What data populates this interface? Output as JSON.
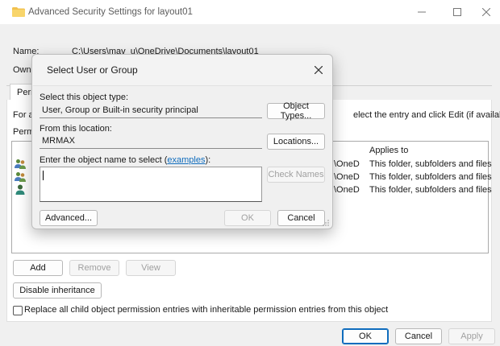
{
  "window": {
    "title": "Advanced Security Settings for layout01",
    "name_label": "Name:",
    "name_value": "C:\\Users\\mav_u\\OneDrive\\Documents\\layout01",
    "owner_label_partial": "Owne",
    "tab_label_partial": "Perm",
    "instruction_left": "For a",
    "instruction_right": "elect the entry and click Edit (if available).",
    "perm_label_partial": "Perm",
    "list": {
      "applies_to_header": "Applies to",
      "rows": [
        {
          "inherited_partial": "\\OneD",
          "applies_to": "This folder, subfolders and files"
        },
        {
          "inherited_partial": "\\OneD",
          "applies_to": "This folder, subfolders and files"
        },
        {
          "inherited_partial": "\\OneD",
          "applies_to": "This folder, subfolders and files"
        }
      ]
    },
    "buttons": {
      "add": "Add",
      "remove": "Remove",
      "view": "View",
      "disable_inheritance": "Disable inheritance",
      "ok": "OK",
      "cancel": "Cancel",
      "apply": "Apply"
    },
    "replace_checkbox_label": "Replace all child object permission entries with inheritable permission entries from this object"
  },
  "dialog": {
    "title": "Select User or Group",
    "object_type_label": "Select this object type:",
    "object_type_value": "User, Group or Built-in security principal",
    "object_types_button": "Object Types...",
    "location_label": "From this location:",
    "location_value": "MRMAX",
    "locations_button": "Locations...",
    "enter_name_label_prefix": "Enter the object name to select (",
    "examples_link": "examples",
    "enter_name_label_suffix": "):",
    "object_name_value": "",
    "check_names_button": "Check Names",
    "advanced_button": "Advanced...",
    "ok_button": "OK",
    "cancel_button": "Cancel"
  },
  "colors": {
    "accent": "#0f6cbd",
    "folder": "#f2c14e"
  }
}
